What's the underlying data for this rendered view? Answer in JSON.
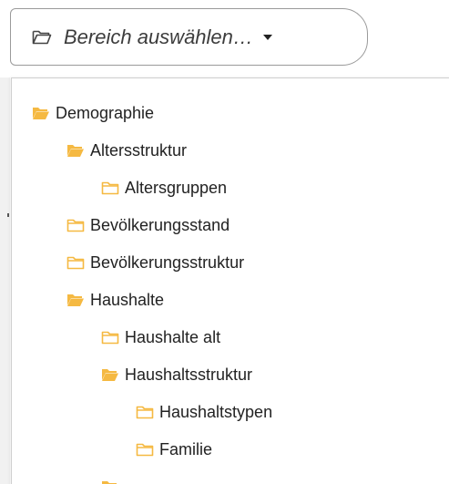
{
  "dropdown": {
    "placeholder": "Bereich auswählen…",
    "button_icon": "folder-outline-icon",
    "caret_icon": "caret-down-icon"
  },
  "tree": {
    "folder_color": "#f5b942",
    "items": [
      {
        "label": "Demographie",
        "level": 0,
        "icon": "folder-open-icon"
      },
      {
        "label": "Altersstruktur",
        "level": 1,
        "icon": "folder-open-icon"
      },
      {
        "label": "Altersgruppen",
        "level": 2,
        "icon": "folder-closed-icon"
      },
      {
        "label": "Bevölkerungsstand",
        "level": 1,
        "icon": "folder-closed-icon"
      },
      {
        "label": "Bevölkerungsstruktur",
        "level": 1,
        "icon": "folder-closed-icon"
      },
      {
        "label": "Haushalte",
        "level": 1,
        "icon": "folder-open-icon"
      },
      {
        "label": "Haushalte alt",
        "level": 2,
        "icon": "folder-closed-icon"
      },
      {
        "label": "Haushaltsstruktur",
        "level": 2,
        "icon": "folder-open-icon"
      },
      {
        "label": "Haushaltstypen",
        "level": 3,
        "icon": "folder-closed-icon"
      },
      {
        "label": "Familie",
        "level": 3,
        "icon": "folder-closed-icon"
      }
    ]
  }
}
